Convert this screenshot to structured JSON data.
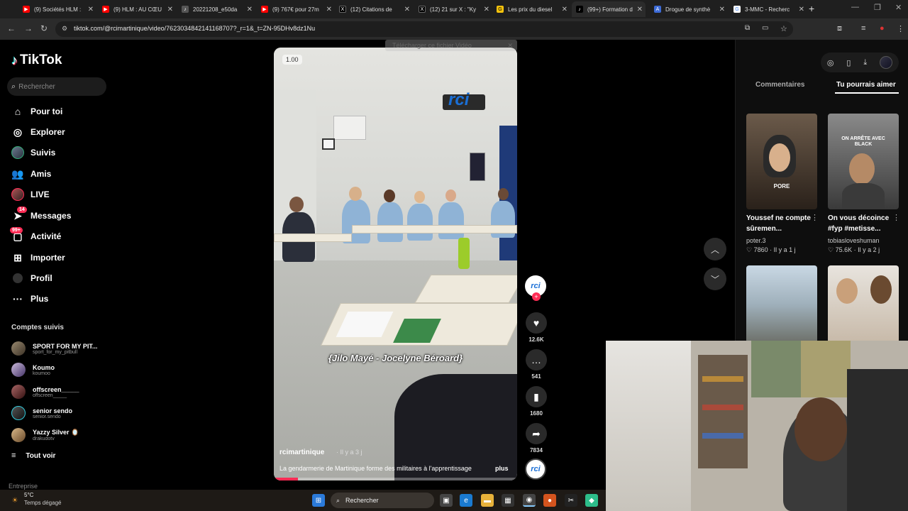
{
  "browser": {
    "tabs": [
      {
        "label": "(9) Sociétés HLM :",
        "icon": "youtube-icon",
        "color": "#ff0000"
      },
      {
        "label": "(9) HLM : AU CŒU",
        "icon": "youtube-icon",
        "color": "#ff0000"
      },
      {
        "label": "20221208_e50da",
        "icon": "music-note-icon",
        "color": "#555555"
      },
      {
        "label": "(9) 767€ pour 27m",
        "icon": "youtube-icon",
        "color": "#ff0000"
      },
      {
        "label": "(12) Citations de",
        "icon": "x-icon",
        "color": "#000000"
      },
      {
        "label": "(12) 21 sur X : \"Ky",
        "icon": "x-icon",
        "color": "#000000"
      },
      {
        "label": "Les prix du diesel",
        "icon": "g-icon",
        "color": "#f4c20d"
      },
      {
        "label": "(99+) Formation d",
        "icon": "tiktok-icon",
        "color": "#000000"
      },
      {
        "label": "Drogue de synthè",
        "icon": "a-icon",
        "color": "#3d6bd6"
      },
      {
        "label": "3-MMC - Recherc",
        "icon": "google-icon",
        "color": "#ffffff"
      }
    ],
    "new_tab": "+",
    "url": "tiktok.com/@rcimartinique/video/7623034842141168707?_r=1&_t=ZN-95DHv8dz1Nu"
  },
  "tiktok": {
    "logo": "TikTok",
    "search_placeholder": "Rechercher",
    "menu": [
      {
        "label": "Pour toi",
        "icon": "home-icon"
      },
      {
        "label": "Explorer",
        "icon": "compass-icon"
      },
      {
        "label": "Suivis",
        "icon": "following-avatar"
      },
      {
        "label": "Amis",
        "icon": "friends-icon"
      },
      {
        "label": "LIVE",
        "icon": "live-avatar"
      },
      {
        "label": "Messages",
        "icon": "send-icon",
        "badge": "14"
      },
      {
        "label": "Activité",
        "icon": "message-icon",
        "badge": "99+"
      },
      {
        "label": "Importer",
        "icon": "upload-icon"
      },
      {
        "label": "Profil",
        "icon": "profile-avatar"
      },
      {
        "label": "Plus",
        "icon": "more-icon"
      }
    ],
    "followed_title": "Comptes suivis",
    "followed": [
      {
        "name": "SPORT FOR MY PIT...",
        "user": "sport_for_my_pitbull"
      },
      {
        "name": "Koumo",
        "user": "koumoo"
      },
      {
        "name": "offscreen_____",
        "user": "offscreen_____"
      },
      {
        "name": "senior sendo",
        "user": "senior.sendo"
      },
      {
        "name": "Yazzy Silver 🪞",
        "user": "drakudotv"
      }
    ],
    "see_all": "Tout voir",
    "entreprise": "Entreprise"
  },
  "video": {
    "speed": "1.00",
    "caption": "{Jilo Mayé - Jocelyne Béroard}",
    "author": "rcimartinique",
    "age": "· Il y a 3 j",
    "description": "La gendarmerie de Martinique forme des militaires à l'apprentissage",
    "more": "plus",
    "progress": 0.1,
    "download_banner": "Télécharger ce fichier Vidéo",
    "creator_mark": "rci",
    "likes": "12.6K",
    "comments": "541",
    "saves": "1680",
    "shares": "7834"
  },
  "right_panel": {
    "tab_comments": "Commentaires",
    "tab_suggest": "Tu pourrais aimer",
    "cards": [
      {
        "title": "Youssef ne compte sûremen...",
        "user": "poter.3",
        "likes": "7860",
        "age": "· Il y a 1 j",
        "overlay": "PORE"
      },
      {
        "title": "On vous décoince #fyp #metisse...",
        "user": "tobiasloveshuman",
        "likes": "75.6K",
        "age": "· Il y a 2 j",
        "overlay": "ON ARRÊTE AVEC BLACK"
      }
    ]
  },
  "taskbar": {
    "temp": "5°C",
    "weather": "Temps dégagé",
    "search": "Rechercher"
  }
}
